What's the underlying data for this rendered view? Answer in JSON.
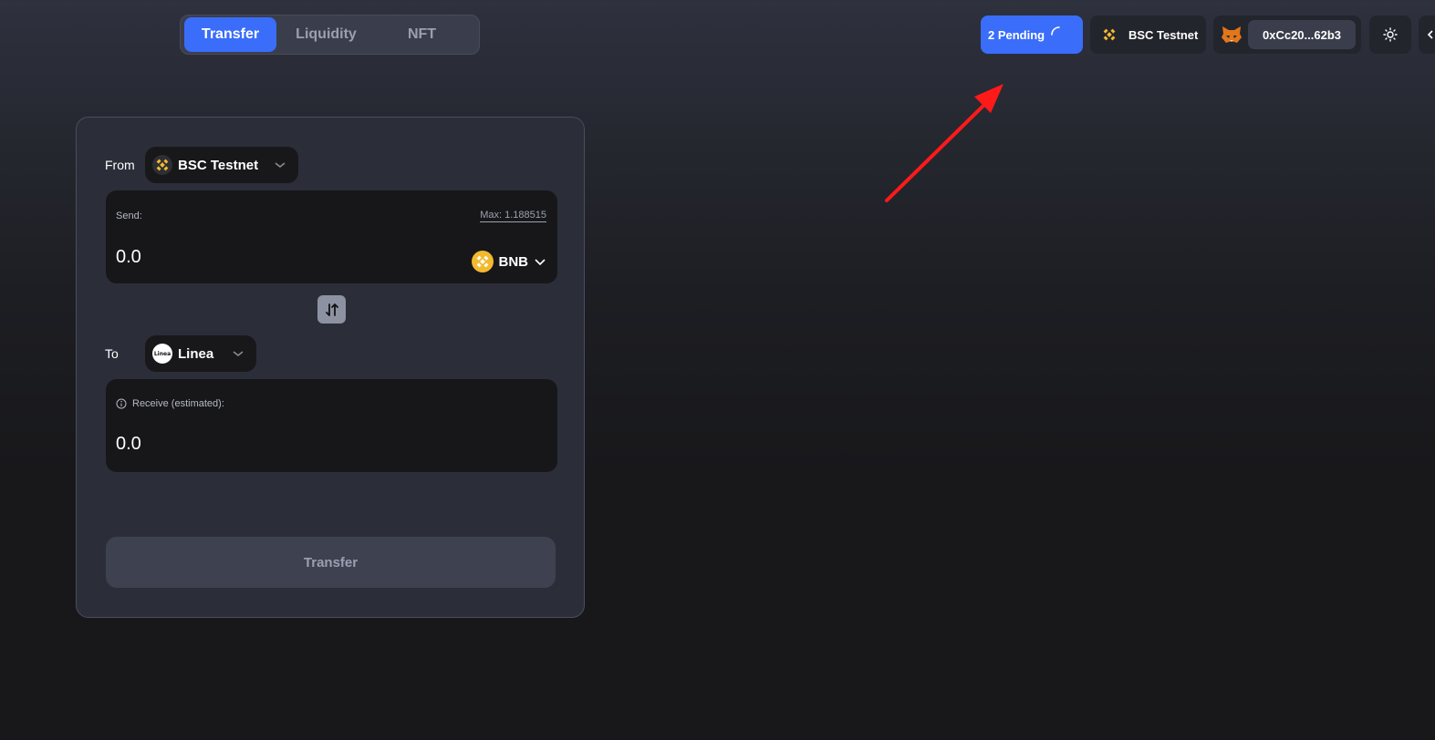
{
  "nav": {
    "tabs": [
      {
        "label": "Transfer",
        "active": true
      },
      {
        "label": "Liquidity",
        "active": false
      },
      {
        "label": "NFT",
        "active": false
      }
    ]
  },
  "header": {
    "pending_label": "2 Pending",
    "network_label": "BSC Testnet",
    "network_icon": "bnb-icon",
    "account_address": "0xCc20...62b3",
    "account_icon": "metamask-fox-icon",
    "theme_icon": "sun-icon"
  },
  "bridge": {
    "from_label": "From",
    "from_chain": "BSC Testnet",
    "send_label": "Send:",
    "max_label": "Max: 1.188515",
    "send_amount": "0.0",
    "token": "BNB",
    "to_label": "To",
    "to_chain": "Linea",
    "to_chain_icon_text": "Linea",
    "receive_label": "Receive (estimated):",
    "receive_amount": "0.0",
    "submit_label": "Transfer"
  },
  "colors": {
    "accent": "#3a6dfa",
    "bnb": "#f3ba2f",
    "annotation": "#ff1a1a"
  }
}
